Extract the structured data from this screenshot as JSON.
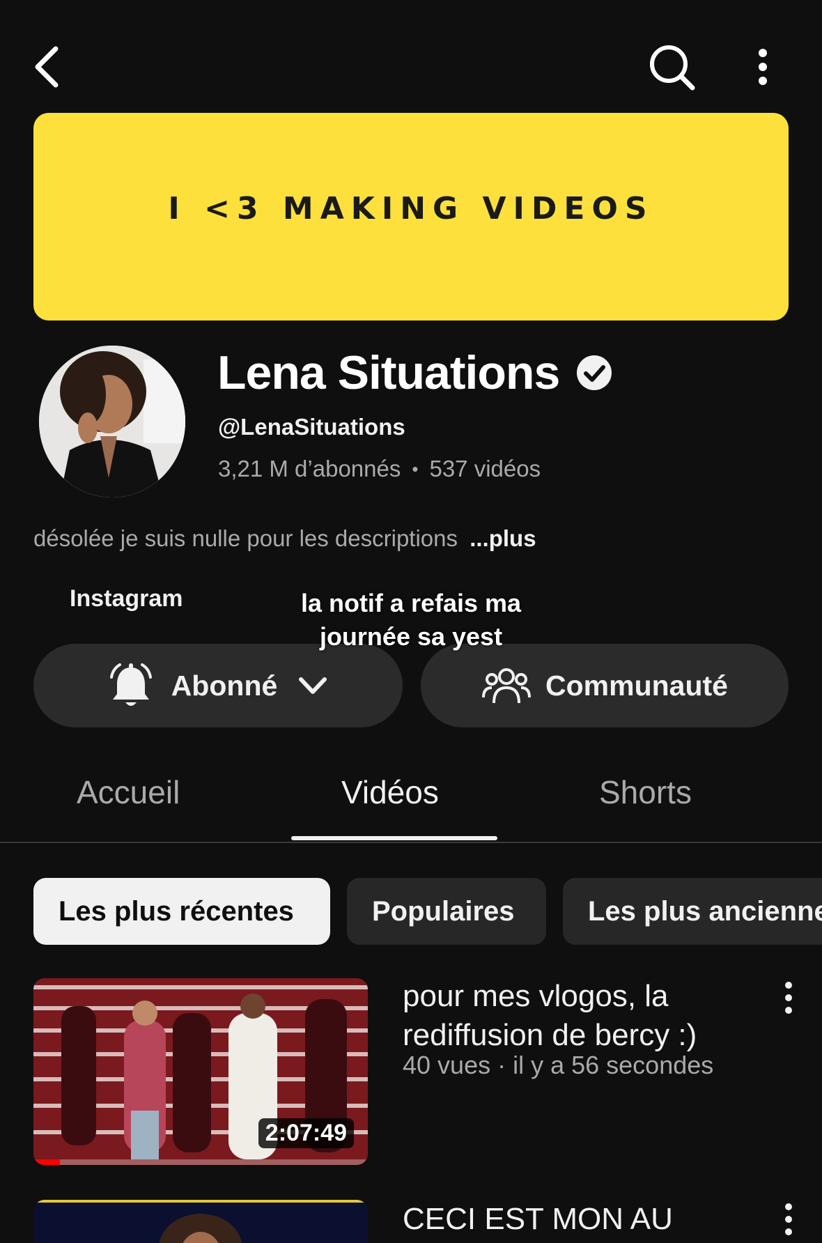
{
  "banner": {
    "text": "I <3 MAKING VIDEOS",
    "color": "#fde03b"
  },
  "channel": {
    "name": "Lena Situations",
    "handle": "@LenaSituations",
    "subscribers": "3,21 M d’abonnés",
    "separator": "•",
    "videos": "537 vidéos",
    "description": "désolée je suis nulle pour les descriptions",
    "more_label": "...plus",
    "link": "Instagram"
  },
  "caption": {
    "line1": "la notif a refais ma",
    "line2": "journée sa yest"
  },
  "buttons": {
    "subscribe": "Abonné",
    "community": "Communauté"
  },
  "tabs": [
    {
      "label": "Accueil"
    },
    {
      "label": "Vidéos",
      "active": true
    },
    {
      "label": "Shorts"
    }
  ],
  "chips": [
    {
      "label": "Les plus récentes",
      "selected": true
    },
    {
      "label": "Populaires"
    },
    {
      "label": "Les plus anciennes"
    }
  ],
  "videos": [
    {
      "title": "pour mes vlogos, la rediffusion de bercy :)",
      "meta": "40 vues · il y a 56 secondes",
      "duration": "2:07:49",
      "progress": 0.08
    },
    {
      "title": "CECI EST MON AU"
    }
  ],
  "icons": [
    "back-icon",
    "search-icon",
    "more-vert-icon",
    "verified-icon",
    "bell-icon",
    "chevron-down-icon",
    "people-icon"
  ],
  "colors": {
    "background": "#0f0f0f",
    "pill": "#2b2b2b",
    "progress": "#ff0000"
  }
}
